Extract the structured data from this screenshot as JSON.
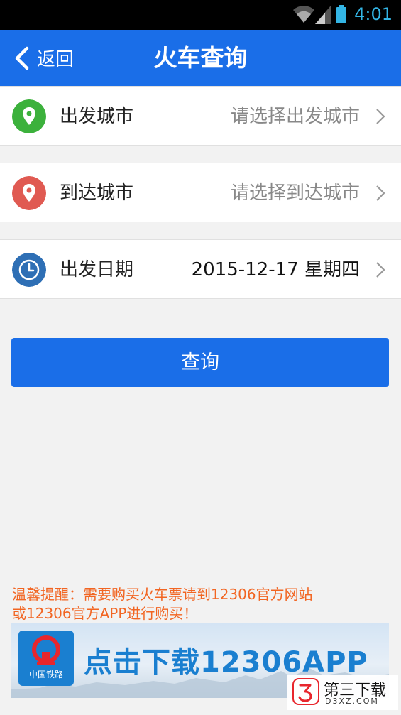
{
  "status_bar": {
    "time": "4:01"
  },
  "nav": {
    "back_label": "返回",
    "title": "火车查询"
  },
  "rows": [
    {
      "label": "出发城市",
      "value": "请选择出发城市",
      "icon": "location-pin-icon",
      "icon_color": "#3cb13c"
    },
    {
      "label": "到达城市",
      "value": "请选择到达城市",
      "icon": "location-pin-icon",
      "icon_color": "#e05a52"
    },
    {
      "label": "出发日期",
      "value": "2015-12-17 星期四",
      "icon": "clock-icon",
      "icon_color": "#2e6fb5"
    }
  ],
  "query_button": {
    "label": "查询"
  },
  "tip": {
    "line1": "温馨提醒：需要购买火车票请到12306官方网站",
    "line2": "或12306官方APP进行购买！"
  },
  "banner": {
    "logo_text": "中国铁路",
    "cta": "点击下载12306APP"
  },
  "watermark": {
    "title": "第三下载",
    "subtitle": "D3XZ.COM"
  },
  "colors": {
    "accent": "#1a6ee8",
    "tip": "#f26522",
    "status_time": "#33b5e5"
  }
}
